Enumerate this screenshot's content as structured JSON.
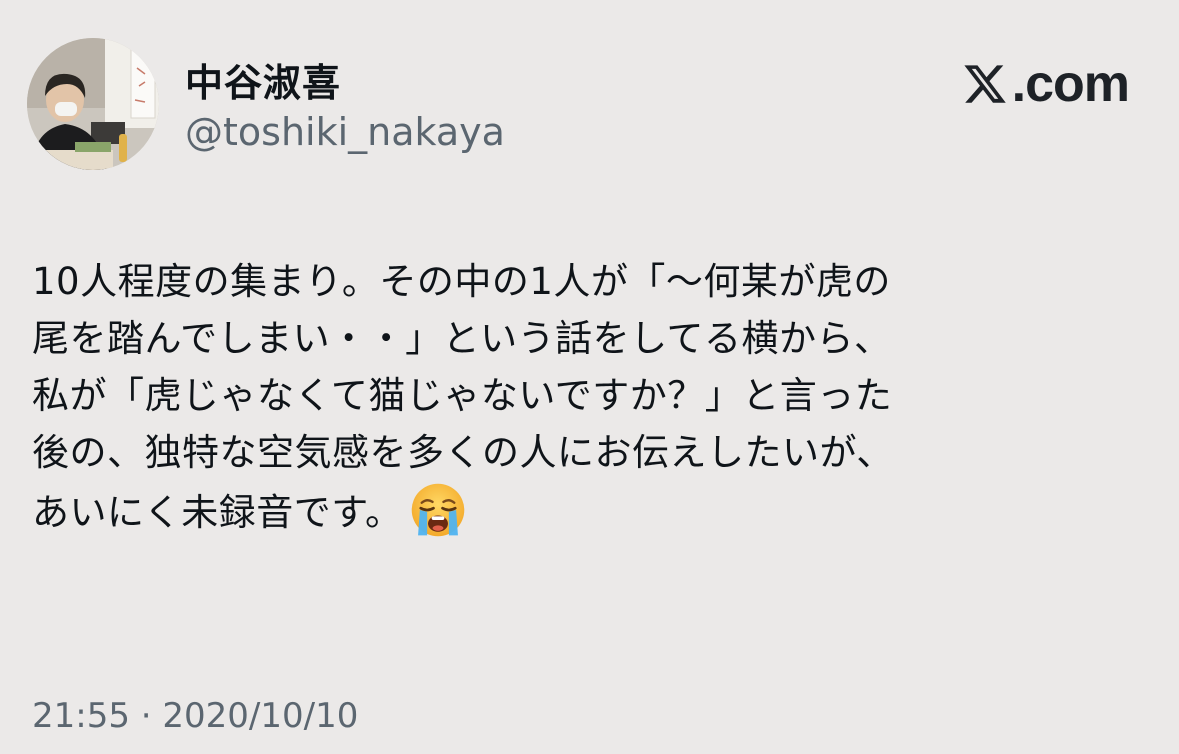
{
  "profile": {
    "display_name": "中谷淑喜",
    "handle": "@toshiki_nakaya",
    "avatar_icon": "profile-photo"
  },
  "brand": {
    "label": ".com",
    "icon": "x-logo-icon"
  },
  "tweet": {
    "lines": [
      "10人程度の集まり。その中の1人が「〜何某が虎の",
      "尾を踏んでしまい・・」という話をしてる横から、",
      "私が「虎じゃなくて猫じゃないですか？」と言った",
      "後の、独特な空気感を多くの人にお伝えしたいが、",
      "あいにく未録音です。"
    ],
    "emoji": "loudly-crying-face-icon"
  },
  "meta": {
    "timestamp": "21:55 · 2020/10/10"
  },
  "colors": {
    "background": "#ebe9e8",
    "text": "#0f1419",
    "secondary_text": "#5b6670"
  }
}
